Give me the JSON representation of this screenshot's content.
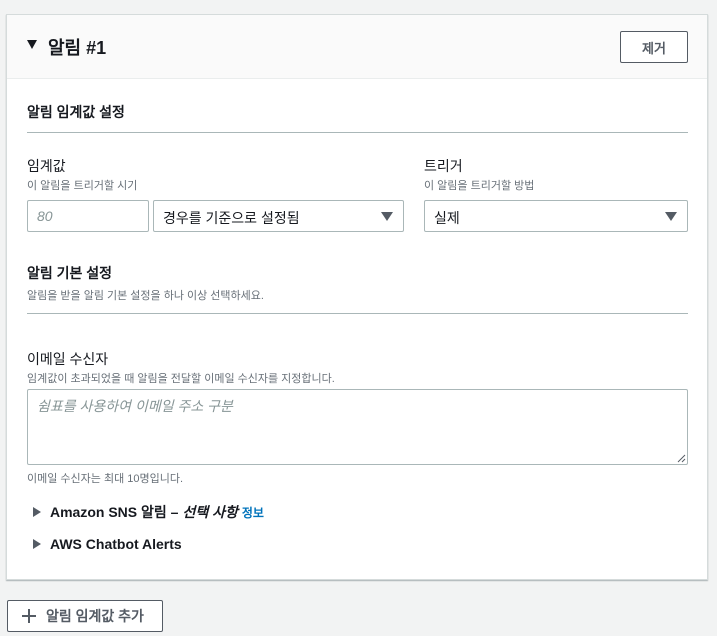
{
  "alarm": {
    "title": "알림 #1",
    "remove_label": "제거"
  },
  "threshold_section": {
    "title": "알림 임계값 설정"
  },
  "threshold": {
    "label": "임계값",
    "description": "이 알림을 트리거할 시기",
    "placeholder": "80",
    "type_selected": "경우를 기준으로 설정됨"
  },
  "trigger": {
    "label": "트리거",
    "description": "이 알림을 트리거할 방법",
    "selected": "실제"
  },
  "preferences_section": {
    "title": "알림 기본 설정",
    "description": "알림을 받을 알림 기본 설정을 하나 이상 선택하세요."
  },
  "email": {
    "label": "이메일 수신자",
    "description": "임계값이 초과되었을 때 알림을 전달할 이메일 수신자를 지정합니다.",
    "placeholder": "쉼표를 사용하여 이메일 주소 구분",
    "hint": "이메일 수신자는 최대 10명입니다."
  },
  "expanders": {
    "sns_label": "Amazon SNS 알림 –",
    "sns_optional": "선택 사항",
    "sns_info": "정보",
    "chatbot_label": "AWS Chatbot Alerts"
  },
  "add_threshold_label": "알림 임계값 추가"
}
